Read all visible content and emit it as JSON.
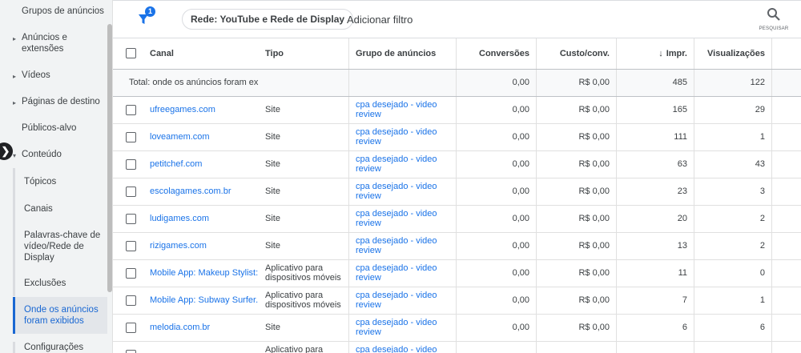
{
  "sidebar": {
    "items": [
      {
        "label": "Grupos de anúncios",
        "arrow": false
      },
      {
        "label": "Anúncios e extensões",
        "arrow": true
      },
      {
        "label": "Vídeos",
        "arrow": true
      },
      {
        "label": "Páginas de destino",
        "arrow": true
      },
      {
        "label": "Públicos-alvo",
        "arrow": false
      },
      {
        "label": "Conteúdo",
        "arrow": true
      }
    ],
    "subitems": [
      {
        "label": "Tópicos"
      },
      {
        "label": "Canais"
      },
      {
        "label": "Palavras-chave de vídeo/Rede de Display"
      },
      {
        "label": "Exclusões"
      },
      {
        "label": "Onde os anúncios foram exibidos"
      },
      {
        "label": "Configurações"
      }
    ],
    "arrow_right": "▸",
    "arrow_down": "▾",
    "collapse_glyph": "❯"
  },
  "toolbar": {
    "filter_badge": "1",
    "network_chip": "Rede: YouTube e Rede de Display",
    "add_filter": "Adicionar filtro",
    "search_label": "PESQUISAR"
  },
  "table": {
    "headers": {
      "canal": "Canal",
      "tipo": "Tipo",
      "grupo": "Grupo de anúncios",
      "conversoes": "Conversões",
      "custo": "Custo/conv.",
      "impr": "Impr.",
      "visualizacoes": "Visualizações",
      "sort_arrow": "↓"
    },
    "total": {
      "label": "Total: onde os anúncios foram exibi...",
      "conversoes": "0,00",
      "custo": "R$ 0,00",
      "impr": "485",
      "visualizacoes": "122"
    },
    "rows": [
      {
        "canal": "ufreegames.com",
        "tipo": "Site",
        "grupo": "cpa desejado - video review",
        "conversoes": "0,00",
        "custo": "R$ 0,00",
        "impr": "165",
        "visualizacoes": "29"
      },
      {
        "canal": "loveamem.com",
        "tipo": "Site",
        "grupo": "cpa desejado - video review",
        "conversoes": "0,00",
        "custo": "R$ 0,00",
        "impr": "111",
        "visualizacoes": "1"
      },
      {
        "canal": "petitchef.com",
        "tipo": "Site",
        "grupo": "cpa desejado - video review",
        "conversoes": "0,00",
        "custo": "R$ 0,00",
        "impr": "63",
        "visualizacoes": "43"
      },
      {
        "canal": "escolagames.com.br",
        "tipo": "Site",
        "grupo": "cpa desejado - video review",
        "conversoes": "0,00",
        "custo": "R$ 0,00",
        "impr": "23",
        "visualizacoes": "3"
      },
      {
        "canal": "ludigames.com",
        "tipo": "Site",
        "grupo": "cpa desejado - video review",
        "conversoes": "0,00",
        "custo": "R$ 0,00",
        "impr": "20",
        "visualizacoes": "2"
      },
      {
        "canal": "rizigames.com",
        "tipo": "Site",
        "grupo": "cpa desejado - video review",
        "conversoes": "0,00",
        "custo": "R$ 0,00",
        "impr": "13",
        "visualizacoes": "2"
      },
      {
        "canal": "Mobile App: Makeup Stylist:...",
        "tipo": "Aplicativo para dispositivos móveis",
        "grupo": "cpa desejado - video review",
        "conversoes": "0,00",
        "custo": "R$ 0,00",
        "impr": "11",
        "visualizacoes": "0"
      },
      {
        "canal": "Mobile App: Subway Surfer...",
        "tipo": "Aplicativo para dispositivos móveis",
        "grupo": "cpa desejado - video review",
        "conversoes": "0,00",
        "custo": "R$ 0,00",
        "impr": "7",
        "visualizacoes": "1"
      },
      {
        "canal": "melodia.com.br",
        "tipo": "Site",
        "grupo": "cpa desejado - video review",
        "conversoes": "0,00",
        "custo": "R$ 0,00",
        "impr": "6",
        "visualizacoes": "6"
      },
      {
        "canal": "",
        "tipo": "Aplicativo para",
        "grupo": "cpa desejado - video",
        "conversoes": "",
        "custo": "",
        "impr": "",
        "visualizacoes": ""
      }
    ]
  },
  "colors": {
    "link": "#1a73e8",
    "active_sidebar": "#1967d2",
    "sidebar_bg": "#f1f3f4"
  }
}
